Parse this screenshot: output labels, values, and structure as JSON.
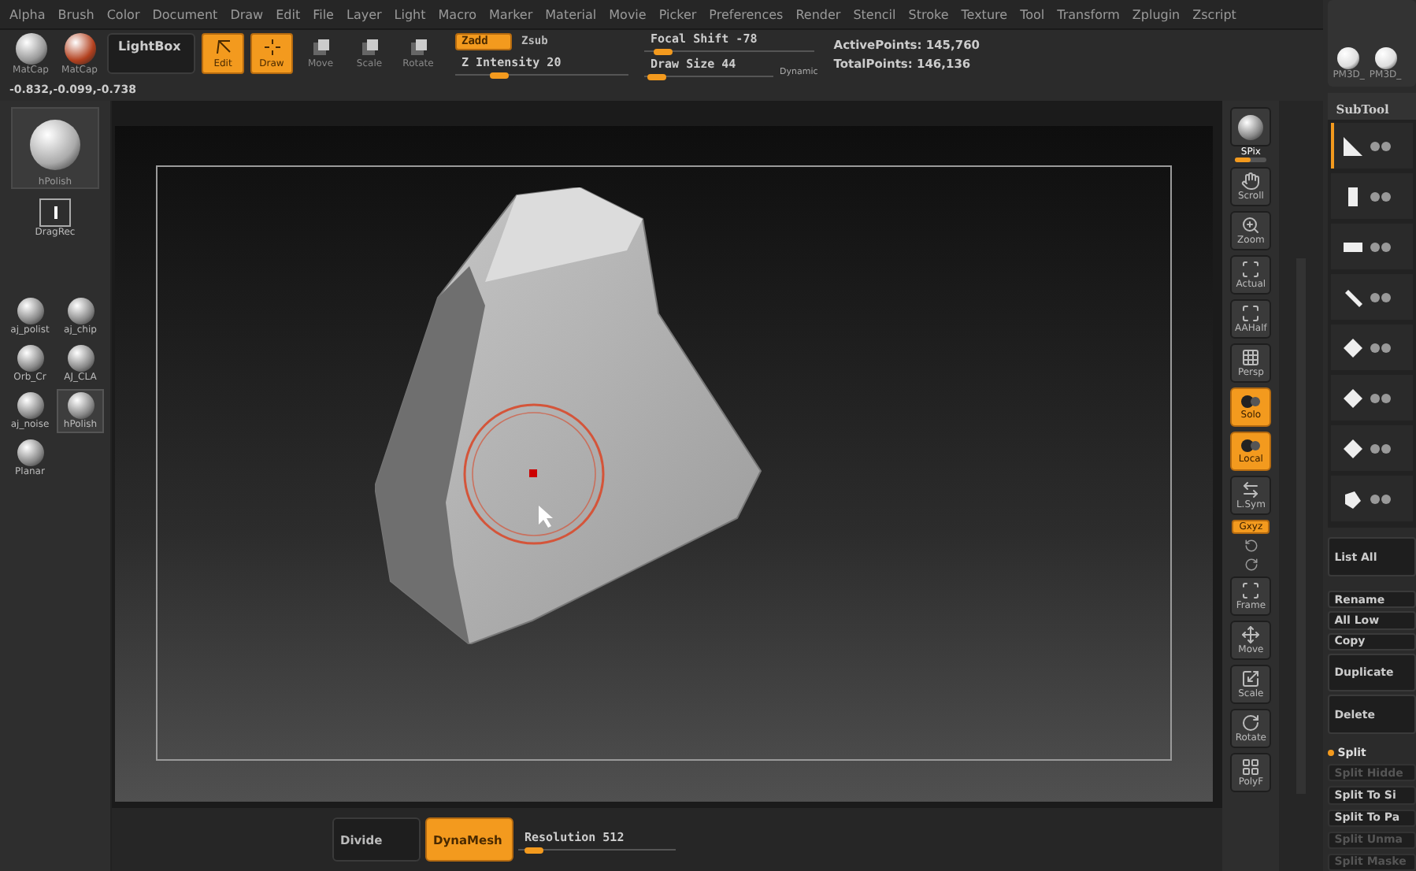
{
  "menu": [
    "Alpha",
    "Brush",
    "Color",
    "Document",
    "Draw",
    "Edit",
    "File",
    "Layer",
    "Light",
    "Macro",
    "Marker",
    "Material",
    "Movie",
    "Picker",
    "Preferences",
    "Render",
    "Stencil",
    "Stroke",
    "Texture",
    "Tool",
    "Transform",
    "Zplugin",
    "Zscript"
  ],
  "toolbar": {
    "materials": [
      "MatCap",
      "MatCap"
    ],
    "lightbox": "LightBox",
    "modes": [
      {
        "label": "Edit",
        "on": true
      },
      {
        "label": "Draw",
        "on": true
      },
      {
        "label": "Move",
        "on": false
      },
      {
        "label": "Scale",
        "on": false
      },
      {
        "label": "Rotate",
        "on": false
      }
    ],
    "zmodes": [
      {
        "label": "Zadd",
        "on": true
      },
      {
        "label": "Zsub",
        "on": false
      }
    ],
    "z_intensity": {
      "label": "Z Intensity 20",
      "level": 0.25
    },
    "focal_shift": {
      "label": "Focal Shift -78",
      "level": 0.11
    },
    "draw_size": {
      "label": "Draw Size 44",
      "level": 0.1
    },
    "dynamic": "Dynamic",
    "active_points": "ActivePoints: 145,760",
    "total_points": "TotalPoints: 146,136"
  },
  "coordinates": "-0.832,-0.099,-0.738",
  "left_shelf": {
    "material": "hPolish",
    "drag": "DragRec",
    "brushes": [
      {
        "label": "aj_polist",
        "selected": false
      },
      {
        "label": "aj_chip",
        "selected": false
      },
      {
        "label": "Orb_Cr",
        "selected": false
      },
      {
        "label": "AJ_CLA",
        "selected": false
      },
      {
        "label": "aj_noise",
        "selected": false
      },
      {
        "label": "hPolish",
        "selected": true
      },
      {
        "label": "Planar",
        "selected": false
      }
    ]
  },
  "right_shelf": [
    {
      "kind": "slider",
      "label": "SPix",
      "level": 0.5
    },
    {
      "kind": "button",
      "label": "Scroll"
    },
    {
      "kind": "button",
      "label": "Zoom"
    },
    {
      "kind": "button",
      "label": "Actual"
    },
    {
      "kind": "button",
      "label": "AAHalf"
    },
    {
      "kind": "button",
      "label": "Persp"
    },
    {
      "kind": "toggle",
      "label": "Solo",
      "on": true
    },
    {
      "kind": "toggle",
      "label": "Local",
      "on": true
    },
    {
      "kind": "button",
      "label": "L.Sym"
    },
    {
      "kind": "axis",
      "label": "Gxyz",
      "on": true
    },
    {
      "kind": "button",
      "label": "Frame"
    },
    {
      "kind": "button",
      "label": "Move"
    },
    {
      "kind": "button",
      "label": "Scale"
    },
    {
      "kind": "button",
      "label": "Rotate"
    },
    {
      "kind": "button",
      "label": "PolyF"
    }
  ],
  "bottom_bar": {
    "buttons": [
      {
        "label": "Divide",
        "on": false
      },
      {
        "label": "DynaMesh",
        "on": true
      }
    ],
    "resolution": {
      "label": "Resolution 512",
      "level": 0.1
    }
  },
  "right_panel": {
    "brushes": [
      "PM3D_",
      "PM3D_"
    ],
    "subtool_title": "SubTool",
    "subtools": [
      {
        "selected": true
      },
      {
        "selected": false
      },
      {
        "selected": false
      },
      {
        "selected": false
      },
      {
        "selected": false
      },
      {
        "selected": false
      },
      {
        "selected": false
      },
      {
        "selected": false
      }
    ],
    "list_all": "List All",
    "actions": [
      {
        "label": "Rename",
        "kind": "small"
      },
      {
        "label": "All Low",
        "kind": "small"
      },
      {
        "label": "Copy",
        "kind": "small"
      },
      {
        "label": "Duplicate",
        "kind": "large"
      },
      {
        "label": "Delete",
        "kind": "large"
      }
    ],
    "split_title": "Split",
    "split_items": [
      {
        "label": "Split Hidde",
        "disabled": true
      },
      {
        "label": "Split To Si",
        "disabled": false
      },
      {
        "label": "Split To Pa",
        "disabled": false
      },
      {
        "label": "Split Unma",
        "disabled": true
      },
      {
        "label": "Split Maske",
        "disabled": true
      }
    ]
  }
}
